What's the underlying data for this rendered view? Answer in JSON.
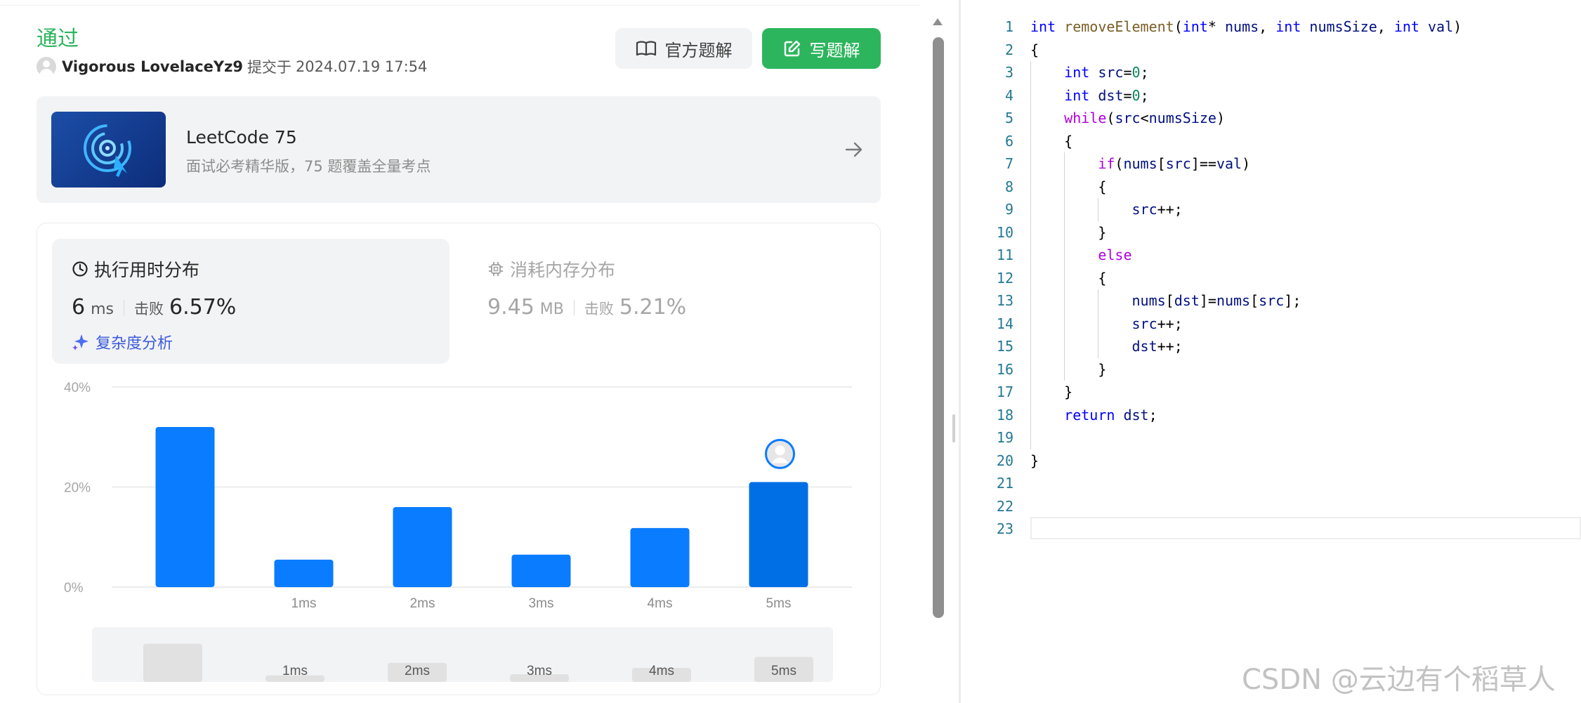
{
  "submission": {
    "status": "通过",
    "user": "Vigorous LovelaceYz9",
    "submitted_label": "提交于",
    "date": "2024.07.19 17:54"
  },
  "buttons": {
    "official_solution": "官方题解",
    "write_solution": "写题解"
  },
  "promo": {
    "title": "LeetCode 75",
    "subtitle": "面试必考精华版，75 题覆盖全量考点"
  },
  "runtime": {
    "title": "执行用时分布",
    "value": "6",
    "unit": "ms",
    "beat_label": "击败",
    "beat": "6.57%",
    "complexity_link": "复杂度分析"
  },
  "memory": {
    "title": "消耗内存分布",
    "value": "9.45",
    "unit": "MB",
    "beat_label": "击败",
    "beat": "5.21%"
  },
  "colors": {
    "accent_green": "#2db55d",
    "bar_blue": "#0a7cff",
    "bar_selected": "#006fe6"
  },
  "chart_data": {
    "type": "bar",
    "categories": [
      "",
      "1ms",
      "2ms",
      "3ms",
      "4ms",
      "5ms"
    ],
    "values": [
      32,
      5.5,
      16,
      6.5,
      11.8,
      21
    ],
    "yticks": [
      "0%",
      "20%",
      "40%"
    ],
    "ylim": [
      0,
      40
    ],
    "highlighted_category": "5ms",
    "grid": true,
    "navigator_labels": [
      "1ms",
      "2ms",
      "3ms",
      "4ms",
      "5ms"
    ]
  },
  "code_lines": [
    "int removeElement(int* nums, int numsSize, int val)",
    "{",
    "    int src=0;",
    "    int dst=0;",
    "    while(src<numsSize)",
    "    {",
    "        if(nums[src]==val)",
    "        {",
    "            src++;",
    "        }",
    "        else",
    "        {",
    "            nums[dst]=nums[src];",
    "            src++;",
    "            dst++;",
    "        }",
    "    }",
    "    return dst;",
    "",
    "}",
    "",
    "",
    ""
  ],
  "watermark": "CSDN @云边有个稻草人"
}
